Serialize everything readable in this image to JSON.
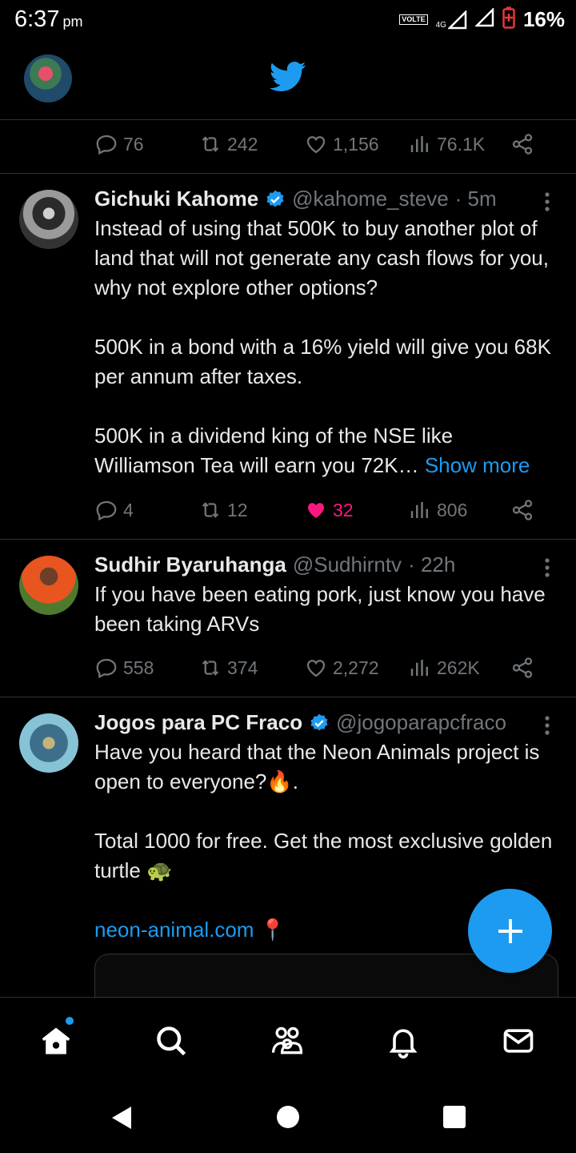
{
  "status_bar": {
    "time": "6:37",
    "ampm": "pm",
    "volte": "VOLTE",
    "network": "4G",
    "battery": "16%"
  },
  "prev_tweet_actions": {
    "replies": "76",
    "retweets": "242",
    "likes": "1,156",
    "views": "76.1K"
  },
  "tweets": [
    {
      "name": "Gichuki Kahome",
      "verified": true,
      "handle": "@kahome_steve",
      "time": "· 5m",
      "paragraphs": [
        "Instead of using that 500K to buy another plot of land that will not generate any cash flows for you, why not explore other options?",
        "500K in a bond with a 16% yield will give you 68K per annum after taxes.",
        "500K in a dividend king of the NSE like Williamson Tea will earn you 72K…"
      ],
      "show_more": "Show more",
      "replies": "4",
      "retweets": "12",
      "likes": "32",
      "views": "806",
      "liked": true
    },
    {
      "name": "Sudhir Byaruhanga",
      "verified": false,
      "handle": "@Sudhirntv",
      "time": "· 22h",
      "paragraphs": [
        "If you have been eating pork, just know you have been taking ARVs"
      ],
      "replies": "558",
      "retweets": "374",
      "likes": "2,272",
      "views": "262K",
      "liked": false
    },
    {
      "name": "Jogos para PC Fraco",
      "verified": true,
      "handle": "@jogoparapcfraco",
      "paragraphs": [
        "Have you heard that the Neon Animals project is open to everyone?🔥.",
        "Total 1000 for free. Get the most exclusive golden turtle 🐢"
      ],
      "link": "neon-animal.com",
      "link_suffix": " 📍"
    }
  ],
  "colors": {
    "accent": "#1d9bf0",
    "like": "#f91880",
    "muted": "#71767b",
    "text": "#e7e9ea",
    "border": "#2f3336"
  },
  "icons": [
    "reply-icon",
    "retweet-icon",
    "like-icon",
    "views-icon",
    "share-icon",
    "home-icon",
    "search-icon",
    "communities-icon",
    "notifications-icon",
    "messages-icon",
    "compose-icon"
  ]
}
